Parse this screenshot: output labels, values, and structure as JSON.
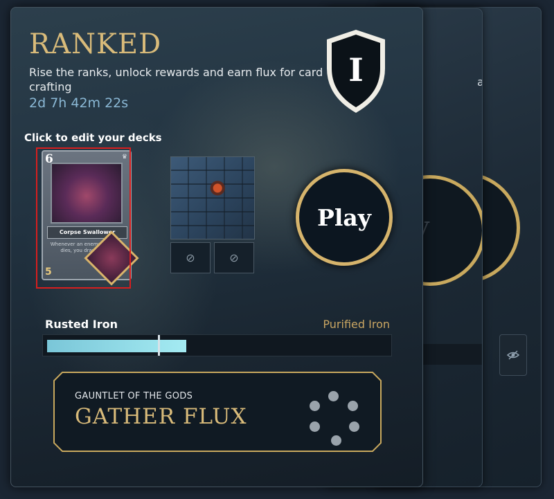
{
  "background_cards": {
    "card_1": {
      "peek_text": "a",
      "button_glyph": "y"
    },
    "card_2": {
      "button_glyph": "t"
    }
  },
  "main": {
    "title": "RANKED",
    "subtitle": "Rise the ranks, unlock rewards and earn flux for card crafting",
    "timer": "2d 7h 42m 22s",
    "rank_badge_numeral": "I",
    "deck_hint": "Click to edit your decks",
    "deck_card": {
      "cost": "6",
      "name": "Corpse Swallower",
      "text": "Whenever an enemy creature dies, you draw a card",
      "power": "5",
      "tribe": "Amalthea"
    },
    "play_label": "Play",
    "rank": {
      "current": "Rusted Iron",
      "next": "Purified Iron",
      "progress_fraction": 0.41
    },
    "quest": {
      "subtitle": "GAUNTLET OF THE GODS",
      "title": "GATHER FLUX"
    }
  },
  "icons": {
    "slot_button_1": "blocked-icon",
    "slot_button_2": "blocked-icon",
    "hidden": "eye-off-icon",
    "loading": "loading-spinner-icon",
    "crown": "crown-icon"
  },
  "colors": {
    "gold_accent": "#d9bb7a",
    "timer_blue": "#8bb9d6",
    "progress_fill": "#a4ebf2",
    "highlight_red": "#d81e1e"
  }
}
